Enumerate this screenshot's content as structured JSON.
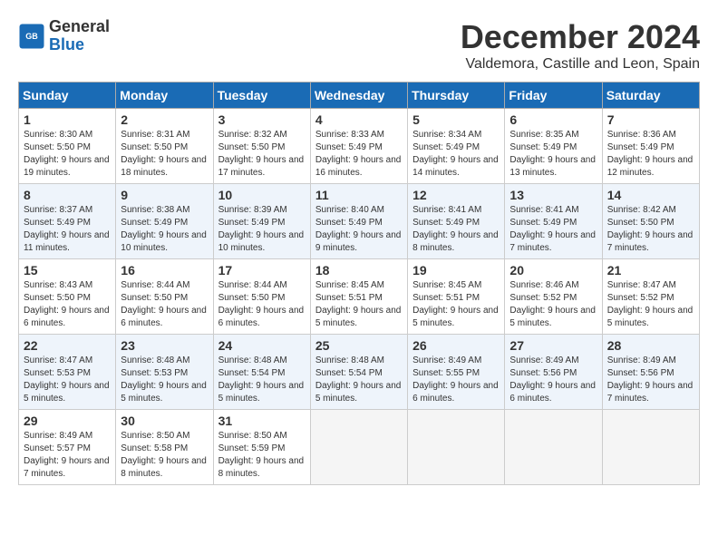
{
  "header": {
    "logo_line1": "General",
    "logo_line2": "Blue",
    "month_title": "December 2024",
    "location": "Valdemora, Castille and Leon, Spain"
  },
  "weekdays": [
    "Sunday",
    "Monday",
    "Tuesday",
    "Wednesday",
    "Thursday",
    "Friday",
    "Saturday"
  ],
  "weeks": [
    [
      {
        "day": "1",
        "sunrise": "8:30 AM",
        "sunset": "5:50 PM",
        "daylight": "9 hours and 19 minutes."
      },
      {
        "day": "2",
        "sunrise": "8:31 AM",
        "sunset": "5:50 PM",
        "daylight": "9 hours and 18 minutes."
      },
      {
        "day": "3",
        "sunrise": "8:32 AM",
        "sunset": "5:50 PM",
        "daylight": "9 hours and 17 minutes."
      },
      {
        "day": "4",
        "sunrise": "8:33 AM",
        "sunset": "5:49 PM",
        "daylight": "9 hours and 16 minutes."
      },
      {
        "day": "5",
        "sunrise": "8:34 AM",
        "sunset": "5:49 PM",
        "daylight": "9 hours and 14 minutes."
      },
      {
        "day": "6",
        "sunrise": "8:35 AM",
        "sunset": "5:49 PM",
        "daylight": "9 hours and 13 minutes."
      },
      {
        "day": "7",
        "sunrise": "8:36 AM",
        "sunset": "5:49 PM",
        "daylight": "9 hours and 12 minutes."
      }
    ],
    [
      {
        "day": "8",
        "sunrise": "8:37 AM",
        "sunset": "5:49 PM",
        "daylight": "9 hours and 11 minutes."
      },
      {
        "day": "9",
        "sunrise": "8:38 AM",
        "sunset": "5:49 PM",
        "daylight": "9 hours and 10 minutes."
      },
      {
        "day": "10",
        "sunrise": "8:39 AM",
        "sunset": "5:49 PM",
        "daylight": "9 hours and 10 minutes."
      },
      {
        "day": "11",
        "sunrise": "8:40 AM",
        "sunset": "5:49 PM",
        "daylight": "9 hours and 9 minutes."
      },
      {
        "day": "12",
        "sunrise": "8:41 AM",
        "sunset": "5:49 PM",
        "daylight": "9 hours and 8 minutes."
      },
      {
        "day": "13",
        "sunrise": "8:41 AM",
        "sunset": "5:49 PM",
        "daylight": "9 hours and 7 minutes."
      },
      {
        "day": "14",
        "sunrise": "8:42 AM",
        "sunset": "5:50 PM",
        "daylight": "9 hours and 7 minutes."
      }
    ],
    [
      {
        "day": "15",
        "sunrise": "8:43 AM",
        "sunset": "5:50 PM",
        "daylight": "9 hours and 6 minutes."
      },
      {
        "day": "16",
        "sunrise": "8:44 AM",
        "sunset": "5:50 PM",
        "daylight": "9 hours and 6 minutes."
      },
      {
        "day": "17",
        "sunrise": "8:44 AM",
        "sunset": "5:50 PM",
        "daylight": "9 hours and 6 minutes."
      },
      {
        "day": "18",
        "sunrise": "8:45 AM",
        "sunset": "5:51 PM",
        "daylight": "9 hours and 5 minutes."
      },
      {
        "day": "19",
        "sunrise": "8:45 AM",
        "sunset": "5:51 PM",
        "daylight": "9 hours and 5 minutes."
      },
      {
        "day": "20",
        "sunrise": "8:46 AM",
        "sunset": "5:52 PM",
        "daylight": "9 hours and 5 minutes."
      },
      {
        "day": "21",
        "sunrise": "8:47 AM",
        "sunset": "5:52 PM",
        "daylight": "9 hours and 5 minutes."
      }
    ],
    [
      {
        "day": "22",
        "sunrise": "8:47 AM",
        "sunset": "5:53 PM",
        "daylight": "9 hours and 5 minutes."
      },
      {
        "day": "23",
        "sunrise": "8:48 AM",
        "sunset": "5:53 PM",
        "daylight": "9 hours and 5 minutes."
      },
      {
        "day": "24",
        "sunrise": "8:48 AM",
        "sunset": "5:54 PM",
        "daylight": "9 hours and 5 minutes."
      },
      {
        "day": "25",
        "sunrise": "8:48 AM",
        "sunset": "5:54 PM",
        "daylight": "9 hours and 5 minutes."
      },
      {
        "day": "26",
        "sunrise": "8:49 AM",
        "sunset": "5:55 PM",
        "daylight": "9 hours and 6 minutes."
      },
      {
        "day": "27",
        "sunrise": "8:49 AM",
        "sunset": "5:56 PM",
        "daylight": "9 hours and 6 minutes."
      },
      {
        "day": "28",
        "sunrise": "8:49 AM",
        "sunset": "5:56 PM",
        "daylight": "9 hours and 7 minutes."
      }
    ],
    [
      {
        "day": "29",
        "sunrise": "8:49 AM",
        "sunset": "5:57 PM",
        "daylight": "9 hours and 7 minutes."
      },
      {
        "day": "30",
        "sunrise": "8:50 AM",
        "sunset": "5:58 PM",
        "daylight": "9 hours and 8 minutes."
      },
      {
        "day": "31",
        "sunrise": "8:50 AM",
        "sunset": "5:59 PM",
        "daylight": "9 hours and 8 minutes."
      },
      null,
      null,
      null,
      null
    ]
  ]
}
